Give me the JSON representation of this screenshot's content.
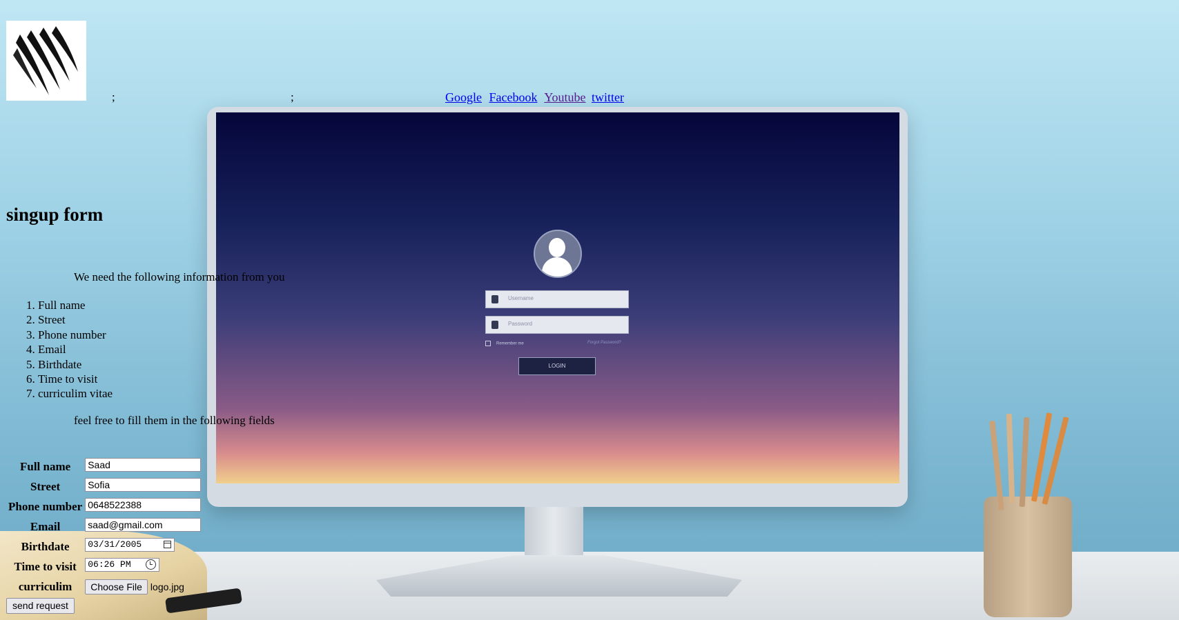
{
  "nav": {
    "separator_1": ";",
    "separator_2": ";",
    "links": [
      {
        "label": "Google"
      },
      {
        "label": "Facebook"
      },
      {
        "label": "Youtube"
      },
      {
        "label": "twitter"
      }
    ]
  },
  "heading": "singup form",
  "intro_text": "We need the following information from you",
  "required_fields": [
    "Full name",
    "Street",
    "Phone number",
    "Email",
    "Birthdate",
    "Time to visit",
    "curriculim vitae"
  ],
  "outro_text": "feel free to fill them in the following fields",
  "form": {
    "full_name": {
      "label": "Full name",
      "value": "Saad"
    },
    "street": {
      "label": "Street",
      "value": "Sofia"
    },
    "phone": {
      "label": "Phone number",
      "value": "0648522388"
    },
    "email": {
      "label": "Email",
      "value": "saad@gmail.com"
    },
    "birthdate": {
      "label": "Birthdate",
      "value": "03/31/2005"
    },
    "time_to_visit": {
      "label": "Time to visit",
      "value": "06:26 PM"
    },
    "curriculum": {
      "label": "curriculim",
      "button": "Choose File",
      "file_name": "logo.jpg"
    },
    "submit_label": "send request"
  },
  "background_screen": {
    "username_placeholder": "Username",
    "password_placeholder": "Password",
    "remember_label": "Remember me",
    "forgot_label": "Forgot Password?",
    "login_label": "LOGIN"
  },
  "colors": {
    "link": "#0000ee",
    "visited_link": "#551a8b"
  }
}
